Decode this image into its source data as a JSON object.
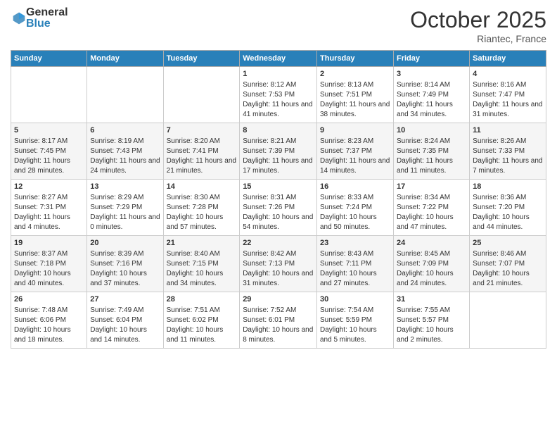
{
  "header": {
    "logo_general": "General",
    "logo_blue": "Blue",
    "title": "October 2025",
    "location": "Riantec, France"
  },
  "days_of_week": [
    "Sunday",
    "Monday",
    "Tuesday",
    "Wednesday",
    "Thursday",
    "Friday",
    "Saturday"
  ],
  "weeks": [
    [
      {
        "day": "",
        "info": ""
      },
      {
        "day": "",
        "info": ""
      },
      {
        "day": "",
        "info": ""
      },
      {
        "day": "1",
        "info": "Sunrise: 8:12 AM\nSunset: 7:53 PM\nDaylight: 11 hours and 41 minutes."
      },
      {
        "day": "2",
        "info": "Sunrise: 8:13 AM\nSunset: 7:51 PM\nDaylight: 11 hours and 38 minutes."
      },
      {
        "day": "3",
        "info": "Sunrise: 8:14 AM\nSunset: 7:49 PM\nDaylight: 11 hours and 34 minutes."
      },
      {
        "day": "4",
        "info": "Sunrise: 8:16 AM\nSunset: 7:47 PM\nDaylight: 11 hours and 31 minutes."
      }
    ],
    [
      {
        "day": "5",
        "info": "Sunrise: 8:17 AM\nSunset: 7:45 PM\nDaylight: 11 hours and 28 minutes."
      },
      {
        "day": "6",
        "info": "Sunrise: 8:19 AM\nSunset: 7:43 PM\nDaylight: 11 hours and 24 minutes."
      },
      {
        "day": "7",
        "info": "Sunrise: 8:20 AM\nSunset: 7:41 PM\nDaylight: 11 hours and 21 minutes."
      },
      {
        "day": "8",
        "info": "Sunrise: 8:21 AM\nSunset: 7:39 PM\nDaylight: 11 hours and 17 minutes."
      },
      {
        "day": "9",
        "info": "Sunrise: 8:23 AM\nSunset: 7:37 PM\nDaylight: 11 hours and 14 minutes."
      },
      {
        "day": "10",
        "info": "Sunrise: 8:24 AM\nSunset: 7:35 PM\nDaylight: 11 hours and 11 minutes."
      },
      {
        "day": "11",
        "info": "Sunrise: 8:26 AM\nSunset: 7:33 PM\nDaylight: 11 hours and 7 minutes."
      }
    ],
    [
      {
        "day": "12",
        "info": "Sunrise: 8:27 AM\nSunset: 7:31 PM\nDaylight: 11 hours and 4 minutes."
      },
      {
        "day": "13",
        "info": "Sunrise: 8:29 AM\nSunset: 7:29 PM\nDaylight: 11 hours and 0 minutes."
      },
      {
        "day": "14",
        "info": "Sunrise: 8:30 AM\nSunset: 7:28 PM\nDaylight: 10 hours and 57 minutes."
      },
      {
        "day": "15",
        "info": "Sunrise: 8:31 AM\nSunset: 7:26 PM\nDaylight: 10 hours and 54 minutes."
      },
      {
        "day": "16",
        "info": "Sunrise: 8:33 AM\nSunset: 7:24 PM\nDaylight: 10 hours and 50 minutes."
      },
      {
        "day": "17",
        "info": "Sunrise: 8:34 AM\nSunset: 7:22 PM\nDaylight: 10 hours and 47 minutes."
      },
      {
        "day": "18",
        "info": "Sunrise: 8:36 AM\nSunset: 7:20 PM\nDaylight: 10 hours and 44 minutes."
      }
    ],
    [
      {
        "day": "19",
        "info": "Sunrise: 8:37 AM\nSunset: 7:18 PM\nDaylight: 10 hours and 40 minutes."
      },
      {
        "day": "20",
        "info": "Sunrise: 8:39 AM\nSunset: 7:16 PM\nDaylight: 10 hours and 37 minutes."
      },
      {
        "day": "21",
        "info": "Sunrise: 8:40 AM\nSunset: 7:15 PM\nDaylight: 10 hours and 34 minutes."
      },
      {
        "day": "22",
        "info": "Sunrise: 8:42 AM\nSunset: 7:13 PM\nDaylight: 10 hours and 31 minutes."
      },
      {
        "day": "23",
        "info": "Sunrise: 8:43 AM\nSunset: 7:11 PM\nDaylight: 10 hours and 27 minutes."
      },
      {
        "day": "24",
        "info": "Sunrise: 8:45 AM\nSunset: 7:09 PM\nDaylight: 10 hours and 24 minutes."
      },
      {
        "day": "25",
        "info": "Sunrise: 8:46 AM\nSunset: 7:07 PM\nDaylight: 10 hours and 21 minutes."
      }
    ],
    [
      {
        "day": "26",
        "info": "Sunrise: 7:48 AM\nSunset: 6:06 PM\nDaylight: 10 hours and 18 minutes."
      },
      {
        "day": "27",
        "info": "Sunrise: 7:49 AM\nSunset: 6:04 PM\nDaylight: 10 hours and 14 minutes."
      },
      {
        "day": "28",
        "info": "Sunrise: 7:51 AM\nSunset: 6:02 PM\nDaylight: 10 hours and 11 minutes."
      },
      {
        "day": "29",
        "info": "Sunrise: 7:52 AM\nSunset: 6:01 PM\nDaylight: 10 hours and 8 minutes."
      },
      {
        "day": "30",
        "info": "Sunrise: 7:54 AM\nSunset: 5:59 PM\nDaylight: 10 hours and 5 minutes."
      },
      {
        "day": "31",
        "info": "Sunrise: 7:55 AM\nSunset: 5:57 PM\nDaylight: 10 hours and 2 minutes."
      },
      {
        "day": "",
        "info": ""
      }
    ]
  ]
}
